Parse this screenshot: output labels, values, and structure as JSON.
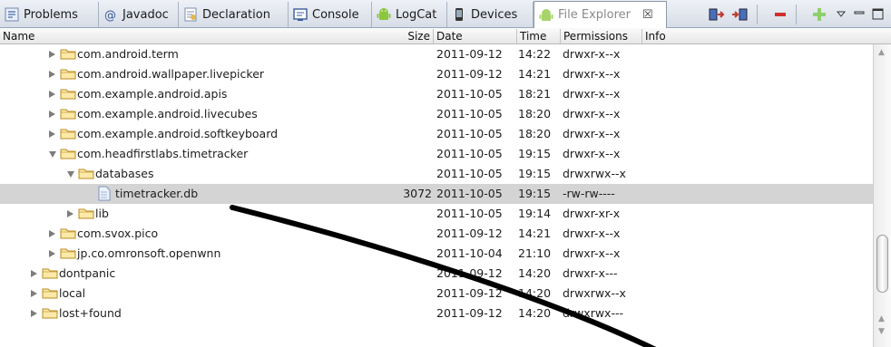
{
  "tabs": [
    {
      "label": "Problems",
      "icon": "problems-icon",
      "active": false
    },
    {
      "label": "Javadoc",
      "icon": "javadoc-icon",
      "active": false
    },
    {
      "label": "Declaration",
      "icon": "declaration-icon",
      "active": false
    },
    {
      "label": "Console",
      "icon": "console-icon",
      "active": false
    },
    {
      "label": "LogCat",
      "icon": "android-icon",
      "active": false
    },
    {
      "label": "Devices",
      "icon": "phone-icon",
      "active": false
    },
    {
      "label": "File Explorer",
      "icon": "android-icon",
      "active": true
    }
  ],
  "close_glyph": "☒",
  "toolbar": {
    "pull": "pull-file-icon",
    "push": "push-file-icon",
    "delete": "delete-icon",
    "add": "new-folder-icon",
    "menu": "view-menu-icon",
    "minimize": "minimize-icon",
    "maximize": "maximize-icon"
  },
  "columns": {
    "name": "Name",
    "size": "Size",
    "date": "Date",
    "time": "Time",
    "permissions": "Permissions",
    "info": "Info"
  },
  "rows": [
    {
      "name": "com.android.term",
      "size": "",
      "date": "2011-09-12",
      "time": "14:22",
      "permissions": "drwxr-x--x"
    },
    {
      "name": "com.android.wallpaper.livepicker",
      "size": "",
      "date": "2011-09-12",
      "time": "14:21",
      "permissions": "drwxr-x--x"
    },
    {
      "name": "com.example.android.apis",
      "size": "",
      "date": "2011-10-05",
      "time": "18:21",
      "permissions": "drwxr-x--x"
    },
    {
      "name": "com.example.android.livecubes",
      "size": "",
      "date": "2011-10-05",
      "time": "18:20",
      "permissions": "drwxr-x--x"
    },
    {
      "name": "com.example.android.softkeyboard",
      "size": "",
      "date": "2011-10-05",
      "time": "18:20",
      "permissions": "drwxr-x--x"
    },
    {
      "name": "com.headfirstlabs.timetracker",
      "size": "",
      "date": "2011-10-05",
      "time": "19:15",
      "permissions": "drwxr-x--x"
    },
    {
      "name": "databases",
      "size": "",
      "date": "2011-10-05",
      "time": "19:15",
      "permissions": "drwxrwx--x"
    },
    {
      "name": "timetracker.db",
      "size": "3072",
      "date": "2011-10-05",
      "time": "19:15",
      "permissions": "-rw-rw----"
    },
    {
      "name": "lib",
      "size": "",
      "date": "2011-10-05",
      "time": "19:14",
      "permissions": "drwxr-xr-x"
    },
    {
      "name": "com.svox.pico",
      "size": "",
      "date": "2011-09-12",
      "time": "14:21",
      "permissions": "drwxr-x--x"
    },
    {
      "name": "jp.co.omronsoft.openwnn",
      "size": "",
      "date": "2011-10-04",
      "time": "21:10",
      "permissions": "drwxr-x--x"
    },
    {
      "name": "dontpanic",
      "size": "",
      "date": "2011-09-12",
      "time": "14:20",
      "permissions": "drwxr-x---"
    },
    {
      "name": "local",
      "size": "",
      "date": "2011-09-12",
      "time": "14:20",
      "permissions": "drwxrwx--x"
    },
    {
      "name": "lost+found",
      "size": "",
      "date": "2011-09-12",
      "time": "14:20",
      "permissions": "drwxrwx---"
    }
  ],
  "colors": {
    "selected_row": "#d4d4d4",
    "annotation_line": "#000000"
  }
}
